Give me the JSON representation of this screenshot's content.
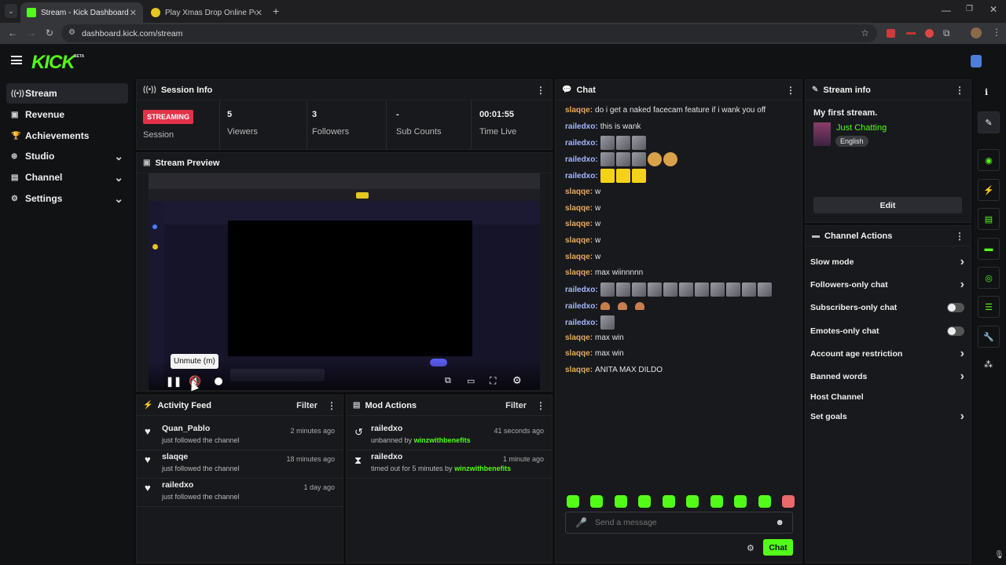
{
  "browser": {
    "tabs": [
      {
        "title": "Stream - Kick Dashboard",
        "active": true
      },
      {
        "title": "Play Xmas Drop Online Pokie | ",
        "active": false
      }
    ],
    "new_tab": "+",
    "url": "dashboard.kick.com/stream"
  },
  "app": {
    "logo": "KICK",
    "logo_badge": "BETA",
    "accent": "#53fc18"
  },
  "sidebar": {
    "items": [
      {
        "label": "Stream",
        "icon": "broadcast-icon",
        "active": true
      },
      {
        "label": "Revenue",
        "icon": "wallet-icon"
      },
      {
        "label": "Achievements",
        "icon": "trophy-icon"
      },
      {
        "label": "Studio",
        "icon": "studio-icon",
        "expandable": true
      },
      {
        "label": "Channel",
        "icon": "channel-icon",
        "expandable": true
      },
      {
        "label": "Settings",
        "icon": "gear-icon",
        "expandable": true
      }
    ]
  },
  "session": {
    "title": "Session Info",
    "status_badge": "STREAMING",
    "status_label": "Session",
    "stats": [
      {
        "value": "5",
        "label": "Viewers"
      },
      {
        "value": "3",
        "label": "Followers"
      },
      {
        "value": "-",
        "label": "Sub Counts"
      },
      {
        "value": "00:01:55",
        "label": "Time Live"
      }
    ]
  },
  "preview": {
    "title": "Stream Preview",
    "tooltip": "Unmute (m)"
  },
  "activity": {
    "title": "Activity Feed",
    "filter": "Filter",
    "items": [
      {
        "name": "Quan_Pablo",
        "sub": "just followed the channel",
        "time": "2 minutes ago"
      },
      {
        "name": "slaqqe",
        "sub": "just followed the channel",
        "time": "18 minutes ago"
      },
      {
        "name": "railedxo",
        "sub": "just followed the channel",
        "time": "1 day ago"
      }
    ]
  },
  "mod": {
    "title": "Mod Actions",
    "filter": "Filter",
    "items": [
      {
        "name": "railedxo",
        "sub": "unbanned by",
        "by": "winzwithbenefits",
        "time": "41 seconds ago"
      },
      {
        "name": "railedxo",
        "sub": "timed out for 5 minutes by",
        "by": "winzwithbenefits",
        "time": "1 minute ago"
      }
    ]
  },
  "chat": {
    "title": "Chat",
    "messages": [
      {
        "user": "slaqqe",
        "text": "do i get a naked facecam feature if i wank you off",
        "color": "#e8a85a"
      },
      {
        "user": "railedxo",
        "text": "this is wank",
        "color": "#a6b7ff"
      },
      {
        "user": "railedxo",
        "text": "",
        "color": "#a6b7ff",
        "emotes": 3
      },
      {
        "user": "railedxo",
        "text": "",
        "color": "#a6b7ff",
        "emotes": 5
      },
      {
        "user": "railedxo",
        "text": "",
        "color": "#a6b7ff",
        "emotes": 3
      },
      {
        "user": "slaqqe",
        "text": "w",
        "color": "#e8a85a"
      },
      {
        "user": "slaqqe",
        "text": "w",
        "color": "#e8a85a"
      },
      {
        "user": "slaqqe",
        "text": "w",
        "color": "#e8a85a"
      },
      {
        "user": "slaqqe",
        "text": "w",
        "color": "#e8a85a"
      },
      {
        "user": "slaqqe",
        "text": "w",
        "color": "#e8a85a"
      },
      {
        "user": "slaqqe",
        "text": "max wiinnnnn",
        "color": "#e8a85a"
      },
      {
        "user": "railedxo",
        "text": "",
        "color": "#a6b7ff",
        "emotes": 11
      },
      {
        "user": "railedxo",
        "text": "",
        "color": "#a6b7ff",
        "emotes": 3
      },
      {
        "user": "railedxo",
        "text": "",
        "color": "#a6b7ff",
        "emotes": 1
      },
      {
        "user": "slaqqe",
        "text": "max win",
        "color": "#e8a85a"
      },
      {
        "user": "slaqqe",
        "text": "max win",
        "color": "#e8a85a"
      },
      {
        "user": "slaqqe",
        "text": "ANITA MAX DILDO",
        "color": "#e8a85a"
      }
    ],
    "placeholder": "Send a message",
    "send": "Chat"
  },
  "stream_info": {
    "title": "Stream info",
    "stream_title": "My first stream.",
    "category": "Just Chatting",
    "language": "English",
    "edit": "Edit"
  },
  "channel_actions": {
    "title": "Channel Actions",
    "items": [
      {
        "label": "Slow mode",
        "kind": "arrow"
      },
      {
        "label": "Followers-only chat",
        "kind": "arrow"
      },
      {
        "label": "Subscribers-only chat",
        "kind": "toggle"
      },
      {
        "label": "Emotes-only chat",
        "kind": "toggle"
      },
      {
        "label": "Account age restriction",
        "kind": "arrow"
      },
      {
        "label": "Banned words",
        "kind": "arrow"
      },
      {
        "label": "Host Channel",
        "kind": "none"
      },
      {
        "label": "Set goals",
        "kind": "arrow"
      }
    ]
  }
}
